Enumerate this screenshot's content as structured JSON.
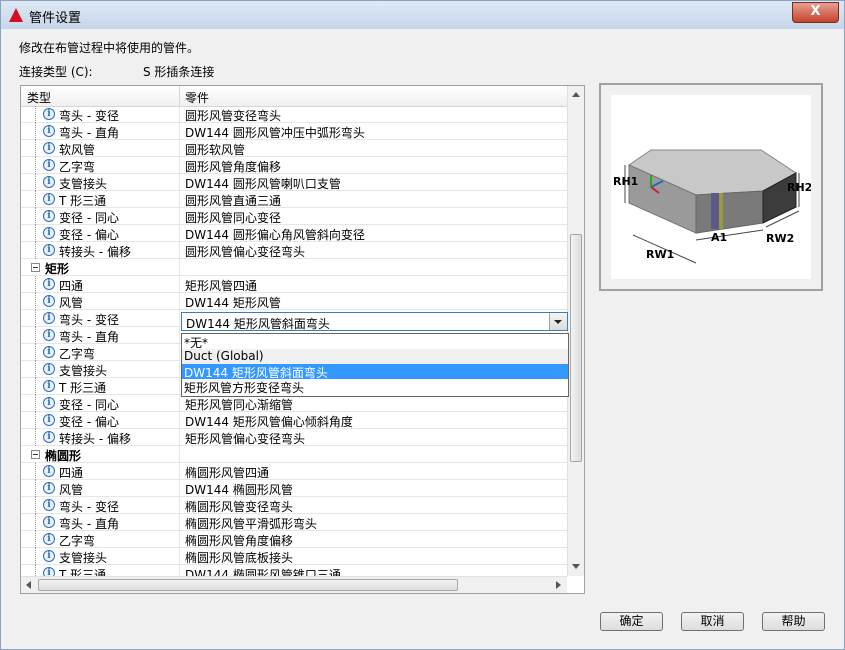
{
  "window": {
    "title": "管件设置",
    "close_label": "X"
  },
  "description": "修改在布管过程中将使用的管件。",
  "connection": {
    "label": "连接类型 (C):",
    "value": "S 形插条连接"
  },
  "table": {
    "col_type": "类型",
    "col_part": "零件",
    "rows": [
      {
        "kind": "item",
        "type": "弯头 - 变径",
        "part": "圆形风管变径弯头"
      },
      {
        "kind": "item",
        "type": "弯头 - 直角",
        "part": "DW144 圆形风管冲压中弧形弯头"
      },
      {
        "kind": "item",
        "type": "软风管",
        "part": "圆形软风管"
      },
      {
        "kind": "item",
        "type": "乙字弯",
        "part": "圆形风管角度偏移"
      },
      {
        "kind": "item",
        "type": "支管接头",
        "part": "DW144 圆形风管喇叭口支管"
      },
      {
        "kind": "item",
        "type": "T 形三通",
        "part": "圆形风管直通三通"
      },
      {
        "kind": "item",
        "type": "变径 - 同心",
        "part": "圆形风管同心变径"
      },
      {
        "kind": "item",
        "type": "变径 - 偏心",
        "part": "DW144 圆形偏心角风管斜向变径"
      },
      {
        "kind": "item",
        "type": "转接头 - 偏移",
        "part": "圆形风管偏心变径弯头"
      },
      {
        "kind": "cat",
        "type": "矩形",
        "part": ""
      },
      {
        "kind": "item",
        "type": "四通",
        "part": "矩形风管四通"
      },
      {
        "kind": "item",
        "type": "风管",
        "part": "DW144 矩形风管"
      },
      {
        "kind": "item",
        "type": "弯头 - 变径",
        "part": ""
      },
      {
        "kind": "item",
        "type": "弯头 - 直角",
        "part": ""
      },
      {
        "kind": "item",
        "type": "乙字弯",
        "part": ""
      },
      {
        "kind": "item",
        "type": "支管接头",
        "part": ""
      },
      {
        "kind": "item",
        "type": "T 形三通",
        "part": ""
      },
      {
        "kind": "item",
        "type": "变径 - 同心",
        "part": "矩形风管同心渐缩管"
      },
      {
        "kind": "item",
        "type": "变径 - 偏心",
        "part": "DW144 矩形风管偏心倾斜角度"
      },
      {
        "kind": "item",
        "type": "转接头 - 偏移",
        "part": "矩形风管偏心变径弯头"
      },
      {
        "kind": "cat",
        "type": "椭圆形",
        "part": ""
      },
      {
        "kind": "item",
        "type": "四通",
        "part": "椭圆形风管四通"
      },
      {
        "kind": "item",
        "type": "风管",
        "part": "DW144 椭圆形风管"
      },
      {
        "kind": "item",
        "type": "弯头 - 变径",
        "part": "椭圆形风管变径弯头"
      },
      {
        "kind": "item",
        "type": "弯头 - 直角",
        "part": "椭圆形风管平滑弧形弯头"
      },
      {
        "kind": "item",
        "type": "乙字弯",
        "part": "椭圆形风管角度偏移"
      },
      {
        "kind": "item",
        "type": "支管接头",
        "part": "椭圆形风管底板接头"
      },
      {
        "kind": "item",
        "type": "T 形三通",
        "part": "DW144 椭圆形风管锥口三通"
      }
    ]
  },
  "combo": {
    "value": "DW144  矩形风管斜面弯头"
  },
  "dropdown": {
    "options": [
      {
        "label": "*无*",
        "state": "normal"
      },
      {
        "label": "Duct (Global)",
        "state": "alt"
      },
      {
        "label": "DW144  矩形风管斜面弯头",
        "state": "selected"
      },
      {
        "label": "矩形风管方形变径弯头",
        "state": "normal"
      }
    ]
  },
  "preview": {
    "labels": {
      "rh1": "RH1",
      "rh2": "RH2",
      "rw1": "RW1",
      "rw2": "RW2",
      "a1": "A1"
    }
  },
  "buttons": {
    "ok": "确定",
    "cancel": "取消",
    "help": "帮助"
  }
}
